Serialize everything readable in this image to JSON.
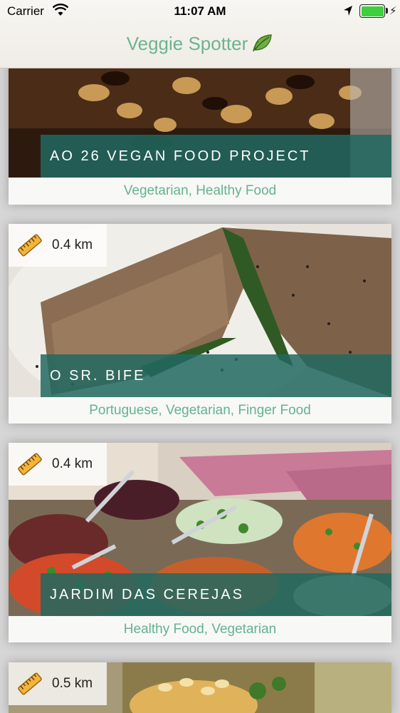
{
  "status_bar": {
    "carrier": "Carrier",
    "time": "11:07 AM",
    "battery_level": 1.0
  },
  "nav": {
    "title": "Veggie Spotter",
    "title_color": "#6cb491"
  },
  "colors": {
    "accent": "#63b38e",
    "band": "#216860"
  },
  "restaurants": [
    {
      "name": "AO 26 VEGAN FOOD PROJECT",
      "tags": "Vegetarian, Healthy Food",
      "distance": ""
    },
    {
      "name": "O SR. BIFE",
      "tags": "Portuguese, Vegetarian, Finger Food",
      "distance": "0.4 km"
    },
    {
      "name": "JARDIM DAS CEREJAS",
      "tags": "Healthy Food, Vegetarian",
      "distance": "0.4 km"
    },
    {
      "name": "",
      "tags": "",
      "distance": "0.5 km"
    }
  ]
}
